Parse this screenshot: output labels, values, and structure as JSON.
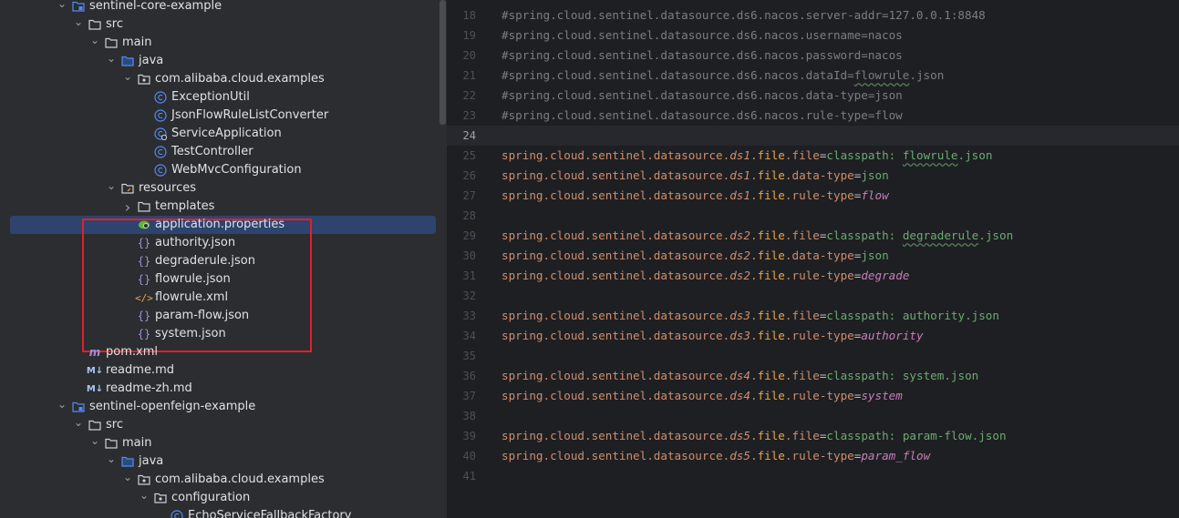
{
  "tree": {
    "rows": [
      {
        "indent": 0,
        "arrow": "down",
        "icon": "module-folder",
        "label": "sentinel-core-example"
      },
      {
        "indent": 1,
        "arrow": "down",
        "icon": "folder",
        "label": "src"
      },
      {
        "indent": 2,
        "arrow": "down",
        "icon": "folder",
        "label": "main"
      },
      {
        "indent": 3,
        "arrow": "down",
        "icon": "source-folder",
        "label": "java"
      },
      {
        "indent": 4,
        "arrow": "down",
        "icon": "package",
        "label": "com.alibaba.cloud.examples"
      },
      {
        "indent": 5,
        "arrow": "none",
        "icon": "class",
        "label": "ExceptionUtil"
      },
      {
        "indent": 5,
        "arrow": "none",
        "icon": "class",
        "label": "JsonFlowRuleListConverter"
      },
      {
        "indent": 5,
        "arrow": "none",
        "icon": "spring-class",
        "label": "ServiceApplication"
      },
      {
        "indent": 5,
        "arrow": "none",
        "icon": "class",
        "label": "TestController"
      },
      {
        "indent": 5,
        "arrow": "none",
        "icon": "class",
        "label": "WebMvcConfiguration"
      },
      {
        "indent": 3,
        "arrow": "down",
        "icon": "resources-folder",
        "label": "resources"
      },
      {
        "indent": 4,
        "arrow": "right",
        "icon": "folder",
        "label": "templates"
      },
      {
        "indent": 4,
        "arrow": "none",
        "icon": "properties",
        "label": "application.properties",
        "selected": true
      },
      {
        "indent": 4,
        "arrow": "none",
        "icon": "json",
        "label": "authority.json"
      },
      {
        "indent": 4,
        "arrow": "none",
        "icon": "json",
        "label": "degraderule.json"
      },
      {
        "indent": 4,
        "arrow": "none",
        "icon": "json",
        "label": "flowrule.json"
      },
      {
        "indent": 4,
        "arrow": "none",
        "icon": "xml",
        "label": "flowrule.xml"
      },
      {
        "indent": 4,
        "arrow": "none",
        "icon": "json",
        "label": "param-flow.json"
      },
      {
        "indent": 4,
        "arrow": "none",
        "icon": "json",
        "label": "system.json"
      },
      {
        "indent": 1,
        "arrow": "none",
        "icon": "maven",
        "label": "pom.xml"
      },
      {
        "indent": 1,
        "arrow": "none",
        "icon": "markdown",
        "label": "readme.md"
      },
      {
        "indent": 1,
        "arrow": "none",
        "icon": "markdown",
        "label": "readme-zh.md"
      },
      {
        "indent": 0,
        "arrow": "down",
        "icon": "module-folder",
        "label": "sentinel-openfeign-example"
      },
      {
        "indent": 1,
        "arrow": "down",
        "icon": "folder",
        "label": "src"
      },
      {
        "indent": 2,
        "arrow": "down",
        "icon": "folder",
        "label": "main"
      },
      {
        "indent": 3,
        "arrow": "down",
        "icon": "source-folder",
        "label": "java"
      },
      {
        "indent": 4,
        "arrow": "down",
        "icon": "package",
        "label": "com.alibaba.cloud.examples"
      },
      {
        "indent": 5,
        "arrow": "down",
        "icon": "package",
        "label": "configuration"
      },
      {
        "indent": 6,
        "arrow": "none",
        "icon": "class",
        "label": "EchoServiceFallbackFactory"
      }
    ]
  },
  "editor": {
    "first_line": 17,
    "current_line": 24,
    "lines": [
      [],
      [
        [
          "c-comment",
          "#spring.cloud.sentinel.datasource.ds6.nacos.server-addr=127.0.0.1:8848"
        ]
      ],
      [
        [
          "c-comment",
          "#spring.cloud.sentinel.datasource.ds6.nacos.username=nacos"
        ]
      ],
      [
        [
          "c-comment",
          "#spring.cloud.sentinel.datasource.ds6.nacos.password=nacos"
        ]
      ],
      [
        [
          "c-comment",
          "#spring.cloud.sentinel.datasource.ds6.nacos.dataId="
        ],
        [
          "c-comment c-underline",
          "flowrule"
        ],
        [
          "c-comment",
          ".json"
        ]
      ],
      [
        [
          "c-comment",
          "#spring.cloud.sentinel.datasource.ds6.nacos.data-type=json"
        ]
      ],
      [
        [
          "c-comment",
          "#spring.cloud.sentinel.datasource.ds6.nacos.rule-type=flow"
        ]
      ],
      [],
      [
        [
          "c-key",
          "spring.cloud.sentinel.datasource."
        ],
        [
          "c-ital",
          "ds1"
        ],
        [
          "c-key",
          "."
        ],
        [
          "c-file",
          "file"
        ],
        [
          "c-key",
          ".file"
        ],
        [
          "c-eq",
          "="
        ],
        [
          "c-val",
          "classpath: "
        ],
        [
          "c-val c-underline",
          "flowrule"
        ],
        [
          "c-val",
          ".json"
        ]
      ],
      [
        [
          "c-key",
          "spring.cloud.sentinel.datasource."
        ],
        [
          "c-ital",
          "ds1"
        ],
        [
          "c-key",
          "."
        ],
        [
          "c-file",
          "file"
        ],
        [
          "c-key",
          ".data-type"
        ],
        [
          "c-eq",
          "="
        ],
        [
          "c-val",
          "json"
        ]
      ],
      [
        [
          "c-key",
          "spring.cloud.sentinel.datasource."
        ],
        [
          "c-ital",
          "ds1"
        ],
        [
          "c-key",
          "."
        ],
        [
          "c-file",
          "file"
        ],
        [
          "c-key",
          ".rule-type"
        ],
        [
          "c-eq",
          "="
        ],
        [
          "c-enum",
          "flow"
        ]
      ],
      [],
      [
        [
          "c-key",
          "spring.cloud.sentinel.datasource."
        ],
        [
          "c-ital",
          "ds2"
        ],
        [
          "c-key",
          "."
        ],
        [
          "c-file",
          "file"
        ],
        [
          "c-key",
          ".file"
        ],
        [
          "c-eq",
          "="
        ],
        [
          "c-val",
          "classpath: "
        ],
        [
          "c-val c-underline",
          "degraderule"
        ],
        [
          "c-val",
          ".json"
        ]
      ],
      [
        [
          "c-key",
          "spring.cloud.sentinel.datasource."
        ],
        [
          "c-ital",
          "ds2"
        ],
        [
          "c-key",
          "."
        ],
        [
          "c-file",
          "file"
        ],
        [
          "c-key",
          ".data-type"
        ],
        [
          "c-eq",
          "="
        ],
        [
          "c-val",
          "json"
        ]
      ],
      [
        [
          "c-key",
          "spring.cloud.sentinel.datasource."
        ],
        [
          "c-ital",
          "ds2"
        ],
        [
          "c-key",
          "."
        ],
        [
          "c-file",
          "file"
        ],
        [
          "c-key",
          ".rule-type"
        ],
        [
          "c-eq",
          "="
        ],
        [
          "c-enum",
          "degrade"
        ]
      ],
      [],
      [
        [
          "c-key",
          "spring.cloud.sentinel.datasource."
        ],
        [
          "c-ital",
          "ds3"
        ],
        [
          "c-key",
          "."
        ],
        [
          "c-file",
          "file"
        ],
        [
          "c-key",
          ".file"
        ],
        [
          "c-eq",
          "="
        ],
        [
          "c-val",
          "classpath: authority.json"
        ]
      ],
      [
        [
          "c-key",
          "spring.cloud.sentinel.datasource."
        ],
        [
          "c-ital",
          "ds3"
        ],
        [
          "c-key",
          "."
        ],
        [
          "c-file",
          "file"
        ],
        [
          "c-key",
          ".rule-type"
        ],
        [
          "c-eq",
          "="
        ],
        [
          "c-enum",
          "authority"
        ]
      ],
      [],
      [
        [
          "c-key",
          "spring.cloud.sentinel.datasource."
        ],
        [
          "c-ital",
          "ds4"
        ],
        [
          "c-key",
          "."
        ],
        [
          "c-file",
          "file"
        ],
        [
          "c-key",
          ".file"
        ],
        [
          "c-eq",
          "="
        ],
        [
          "c-val",
          "classpath: system.json"
        ]
      ],
      [
        [
          "c-key",
          "spring.cloud.sentinel.datasource."
        ],
        [
          "c-ital",
          "ds4"
        ],
        [
          "c-key",
          "."
        ],
        [
          "c-file",
          "file"
        ],
        [
          "c-key",
          ".rule-type"
        ],
        [
          "c-eq",
          "="
        ],
        [
          "c-enum",
          "system"
        ]
      ],
      [],
      [
        [
          "c-key",
          "spring.cloud.sentinel.datasource."
        ],
        [
          "c-ital",
          "ds5"
        ],
        [
          "c-key",
          "."
        ],
        [
          "c-file",
          "file"
        ],
        [
          "c-key",
          ".file"
        ],
        [
          "c-eq",
          "="
        ],
        [
          "c-val",
          "classpath: param-flow.json"
        ]
      ],
      [
        [
          "c-key",
          "spring.cloud.sentinel.datasource."
        ],
        [
          "c-ital",
          "ds5"
        ],
        [
          "c-key",
          "."
        ],
        [
          "c-file",
          "file"
        ],
        [
          "c-key",
          ".rule-type"
        ],
        [
          "c-eq",
          "="
        ],
        [
          "c-enum",
          "param_flow"
        ]
      ],
      []
    ]
  },
  "colors": {
    "tree_bg": "#2b2d30",
    "editor_bg": "#1e1f22",
    "selection": "#2e436e",
    "highlight_box": "#e0202a"
  }
}
